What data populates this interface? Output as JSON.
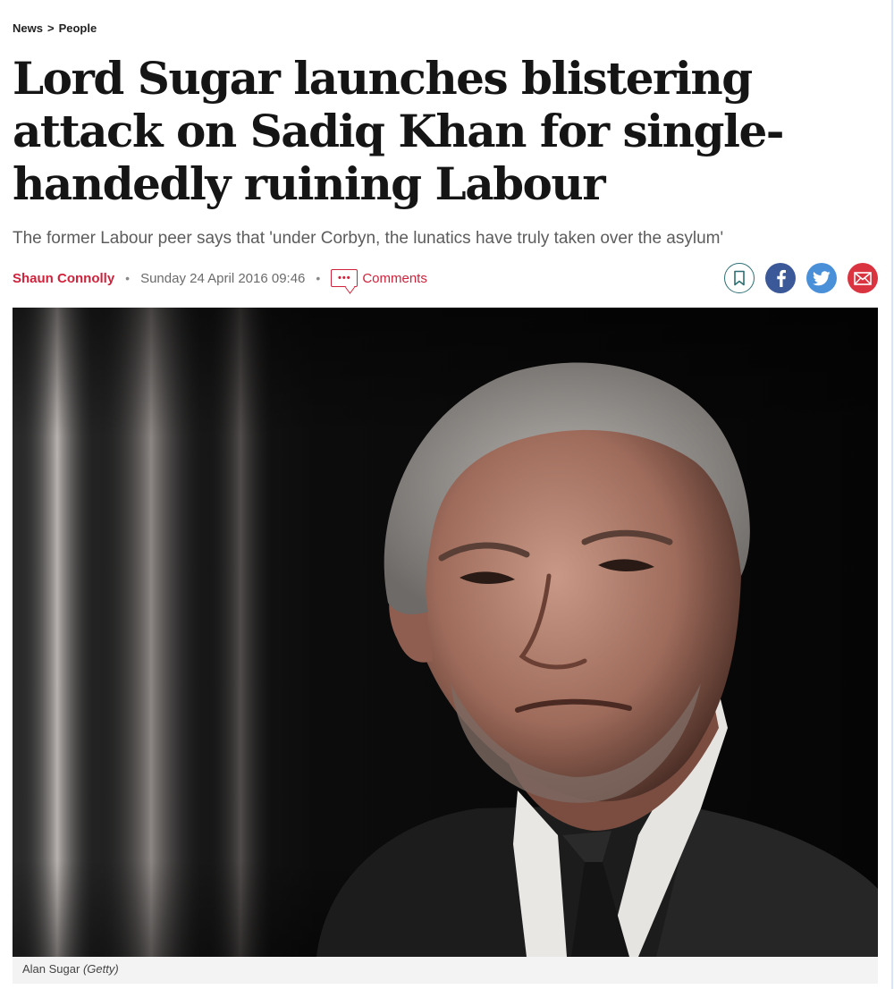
{
  "breadcrumb": {
    "section": "News",
    "separator": ">",
    "subsection": "People"
  },
  "headline": "Lord Sugar launches blistering attack on Sadiq Khan for single-handedly ruining Labour",
  "standfirst": "The former Labour peer says that 'under Corbyn, the lunatics have truly taken over the asylum'",
  "meta": {
    "author": "Shaun Connolly",
    "separator": "•",
    "date": "Sunday 24 April 2016 09:46",
    "comments_label": "Comments",
    "comments_icon_text": "•••"
  },
  "share": {
    "icons": [
      "bookmark-icon",
      "facebook-icon",
      "twitter-icon",
      "email-icon"
    ]
  },
  "image": {
    "caption_name": "Alan Sugar",
    "caption_credit": "(Getty)"
  },
  "colors": {
    "accent": "#d1223b",
    "bookmark": "#2b6f73",
    "facebook": "#3b5998",
    "twitter": "#4a90d9",
    "email": "#d9343f"
  }
}
